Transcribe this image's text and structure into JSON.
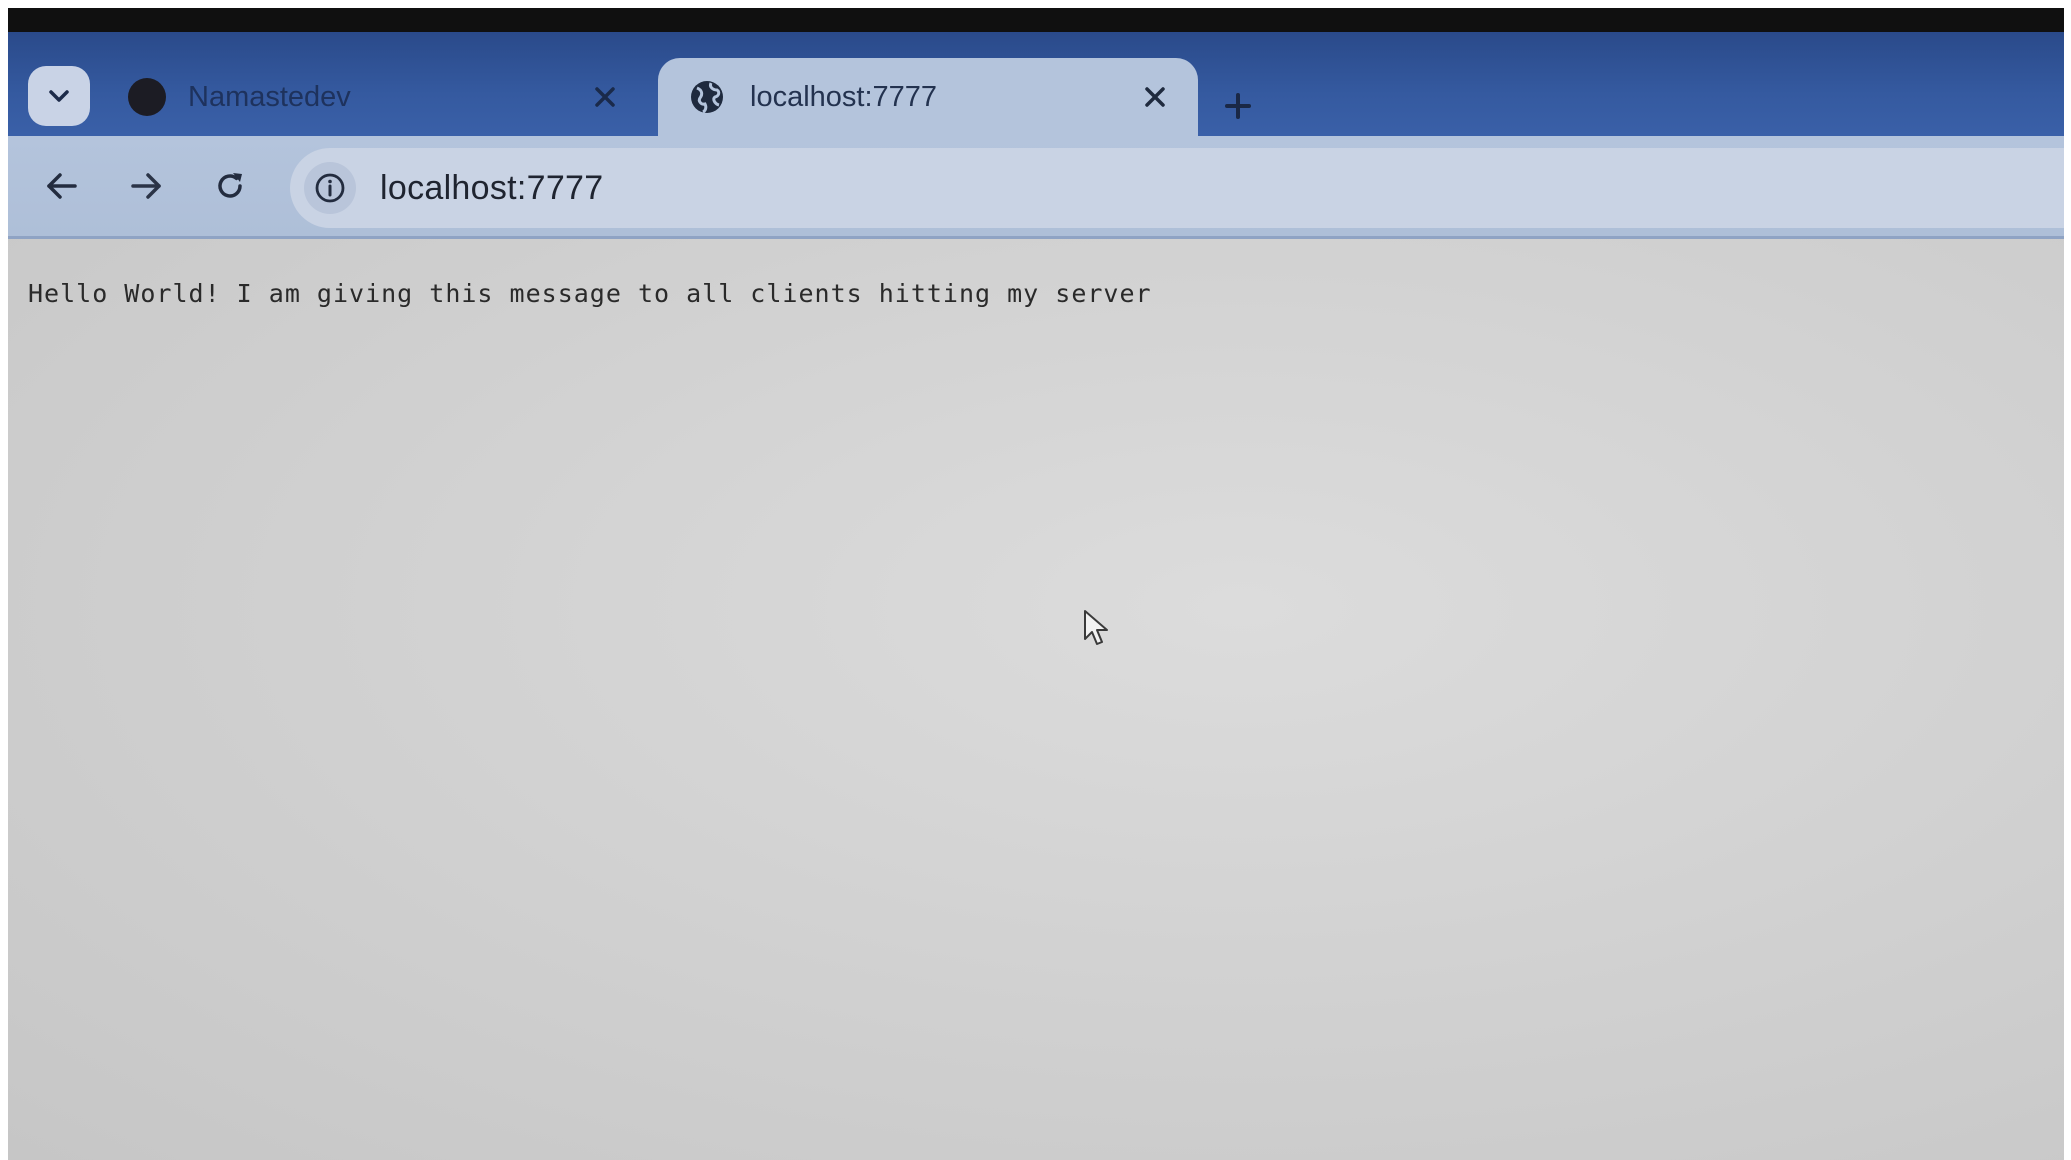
{
  "browser": {
    "tabs": [
      {
        "title": "Namastedev",
        "active": false,
        "favicon": "dark-circle-icon"
      },
      {
        "title": "localhost:7777",
        "active": true,
        "favicon": "globe-icon"
      }
    ],
    "address_bar": {
      "url": "localhost:7777",
      "site_info_icon": "info-icon"
    },
    "nav_icons": [
      "arrow-left-icon",
      "arrow-right-icon",
      "reload-icon"
    ],
    "new_tab_icon": "plus-icon",
    "tab_search_icon": "chevron-down-icon"
  },
  "page": {
    "body_text": "Hello World! I am giving this message to all clients hitting my server"
  },
  "colors": {
    "tabstrip": "#355aa0",
    "toolbar": "#b4c4dc",
    "page_background": "#d4d4d4"
  }
}
